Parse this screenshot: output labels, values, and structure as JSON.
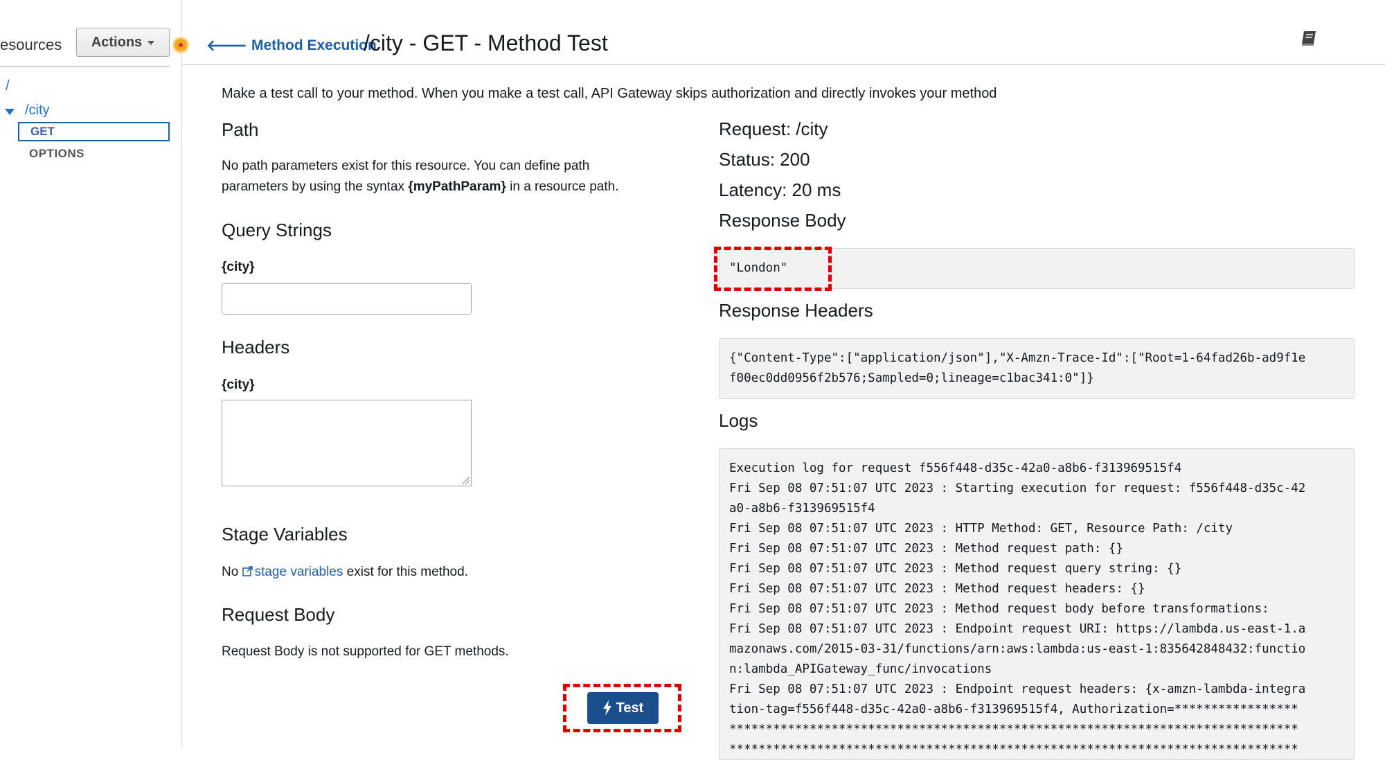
{
  "left_panel": {
    "resources_label": "esources",
    "actions_label": "Actions",
    "tree": {
      "root": "/",
      "city": "/city",
      "methods": [
        "GET",
        "OPTIONS"
      ]
    }
  },
  "header": {
    "back_link": "Method Execution",
    "title": "/city - GET - Method Test"
  },
  "intro": "Make a test call to your method. When you make a test call, API Gateway skips authorization and directly invokes your method",
  "form": {
    "path": {
      "heading": "Path",
      "text_before": "No path parameters exist for this resource. You can define path",
      "text_mid": "parameters by using the syntax ",
      "syntax": "{myPathParam}",
      "text_after": " in a resource path."
    },
    "query_strings": {
      "heading": "Query Strings",
      "param_label": "{city}",
      "value": ""
    },
    "headers": {
      "heading": "Headers",
      "param_label": "{city}",
      "value": ""
    },
    "stage_variables": {
      "heading": "Stage Variables",
      "prefix": "No ",
      "link": "stage variables",
      "suffix": " exist for this method."
    },
    "request_body": {
      "heading": "Request Body",
      "text": "Request Body is not supported for GET methods."
    },
    "test_button": "Test"
  },
  "result": {
    "request": "Request: /city",
    "status": "Status: 200",
    "latency": "Latency: 20 ms",
    "response_body_heading": "Response Body",
    "response_body": "\"London\"",
    "response_headers_heading": "Response Headers",
    "response_headers": "{\"Content-Type\":[\"application/json\"],\"X-Amzn-Trace-Id\":[\"Root=1-64fad26b-ad9f1e\nf00ec0dd0956f2b576;Sampled=0;lineage=c1bac341:0\"]}",
    "logs_heading": "Logs",
    "logs": "Execution log for request f556f448-d35c-42a0-a8b6-f313969515f4\nFri Sep 08 07:51:07 UTC 2023 : Starting execution for request: f556f448-d35c-42\na0-a8b6-f313969515f4\nFri Sep 08 07:51:07 UTC 2023 : HTTP Method: GET, Resource Path: /city\nFri Sep 08 07:51:07 UTC 2023 : Method request path: {}\nFri Sep 08 07:51:07 UTC 2023 : Method request query string: {}\nFri Sep 08 07:51:07 UTC 2023 : Method request headers: {}\nFri Sep 08 07:51:07 UTC 2023 : Method request body before transformations:\nFri Sep 08 07:51:07 UTC 2023 : Endpoint request URI: https://lambda.us-east-1.a\nmazonaws.com/2015-03-31/functions/arn:aws:lambda:us-east-1:835642848432:functio\nn:lambda_APIGateway_func/invocations\nFri Sep 08 07:51:07 UTC 2023 : Endpoint request headers: {x-amzn-lambda-integra\ntion-tag=f556f448-d35c-42a0-a8b6-f313969515f4, Authorization=*****************\n******************************************************************************\n******************************************************************************"
  },
  "icons": {
    "back": "arrow-left-icon",
    "book": "book-icon",
    "external": "external-link-icon",
    "bolt": "lightning-bolt-icon",
    "status_dot": "status-dot-icon"
  },
  "colors": {
    "link": "#1f5fa6",
    "test_button": "#1a4f8b",
    "highlight": "#e00000",
    "code_bg": "#f2f2f2"
  }
}
